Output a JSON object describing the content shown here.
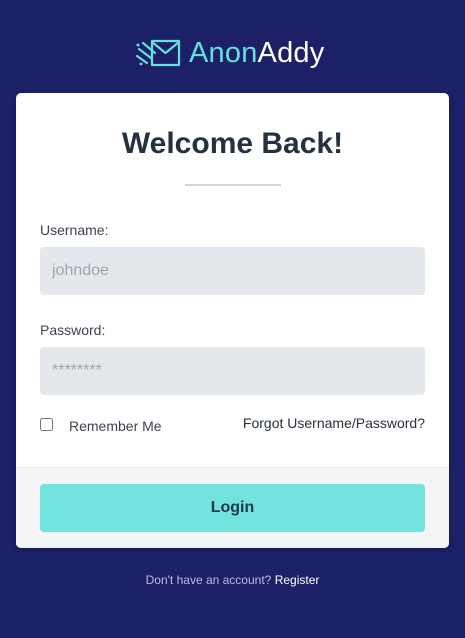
{
  "logo": {
    "text_part1": "Anon",
    "text_part2": "Addy",
    "icon": "envelope-speed-icon",
    "accent_color": "#62e2dc"
  },
  "colors": {
    "background": "#1c2167",
    "card": "#ffffff",
    "input_bg": "#e4e7eb",
    "button": "#72e3df"
  },
  "card": {
    "title": "Welcome Back!",
    "username": {
      "label": "Username:",
      "placeholder": "johndoe",
      "value": ""
    },
    "password": {
      "label": "Password:",
      "placeholder": "********",
      "value": ""
    },
    "remember": {
      "label": "Remember Me",
      "checked": false
    },
    "forgot_link": "Forgot Username/Password?",
    "login_button": "Login"
  },
  "footer": {
    "text": "Don't have an account?",
    "register_link": "Register"
  }
}
